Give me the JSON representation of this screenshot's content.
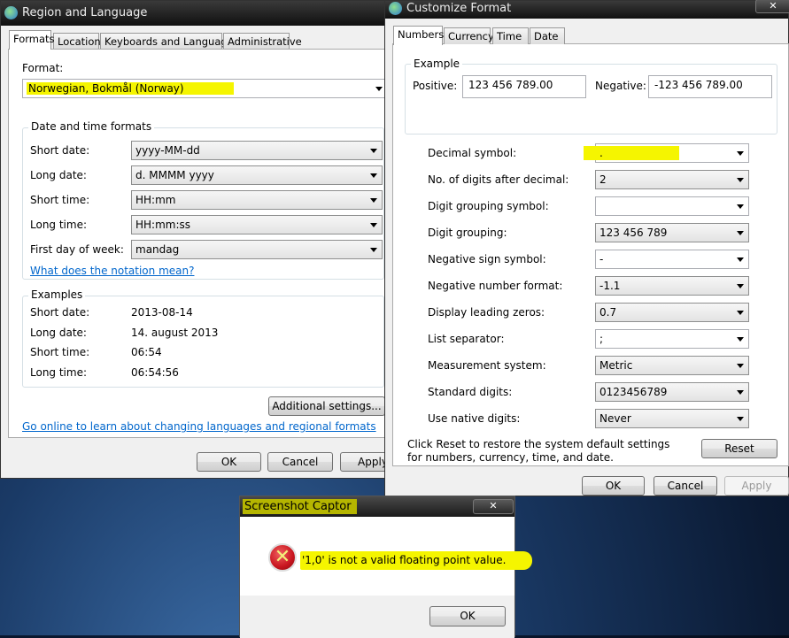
{
  "region": {
    "title": "Region and Language",
    "tabs": [
      "Formats",
      "Location",
      "Keyboards and Languages",
      "Administrative"
    ],
    "format_label": "Format:",
    "format_value": "Norwegian, Bokmål (Norway)",
    "datetime_group": "Date and time formats",
    "rows": [
      {
        "label": "Short date:",
        "value": "yyyy-MM-dd"
      },
      {
        "label": "Long date:",
        "value": "d. MMMM yyyy"
      },
      {
        "label": "Short time:",
        "value": "HH:mm"
      },
      {
        "label": "Long time:",
        "value": "HH:mm:ss"
      },
      {
        "label": "First day of week:",
        "value": "mandag"
      }
    ],
    "notation_link": "What does the notation mean?",
    "examples_group": "Examples",
    "examples": [
      {
        "label": "Short date:",
        "value": "2013-08-14"
      },
      {
        "label": "Long date:",
        "value": "14. august 2013"
      },
      {
        "label": "Short time:",
        "value": "06:54"
      },
      {
        "label": "Long time:",
        "value": "06:54:56"
      }
    ],
    "additional_button": "Additional settings...",
    "online_link": "Go online to learn about changing languages and regional formats",
    "ok": "OK",
    "cancel": "Cancel",
    "apply": "Apply"
  },
  "customize": {
    "title": "Customize Format",
    "tabs": [
      "Numbers",
      "Currency",
      "Time",
      "Date"
    ],
    "example_group": "Example",
    "positive_label": "Positive:",
    "positive_value": "123 456 789.00",
    "negative_label": "Negative:",
    "negative_value": "-123 456 789.00",
    "rows": [
      {
        "label": "Decimal symbol:",
        "value": ".",
        "highlight": true
      },
      {
        "label": "No. of digits after decimal:",
        "value": "2",
        "style": "list"
      },
      {
        "label": "Digit grouping symbol:",
        "value": ""
      },
      {
        "label": "Digit grouping:",
        "value": "123 456 789",
        "style": "list"
      },
      {
        "label": "Negative sign symbol:",
        "value": "-"
      },
      {
        "label": "Negative number format:",
        "value": "-1.1",
        "style": "list"
      },
      {
        "label": "Display leading zeros:",
        "value": "0.7",
        "style": "list"
      },
      {
        "label": "List separator:",
        "value": ";"
      },
      {
        "label": "Measurement system:",
        "value": "Metric",
        "style": "list"
      },
      {
        "label": "Standard digits:",
        "value": "0123456789",
        "style": "list"
      },
      {
        "label": "Use native digits:",
        "value": "Never",
        "style": "list"
      }
    ],
    "reset_text": "Click Reset to restore the system default settings for numbers, currency, time, and date.",
    "reset": "Reset",
    "ok": "OK",
    "cancel": "Cancel",
    "apply": "Apply"
  },
  "error_dialog": {
    "title": "Screenshot Captor",
    "message": "'1,0' is not a valid floating point value.",
    "ok": "OK",
    "icon": "error-icon"
  },
  "colors": {
    "highlight": "#f5f500",
    "link": "#0066cc",
    "error": "#c8141e"
  }
}
